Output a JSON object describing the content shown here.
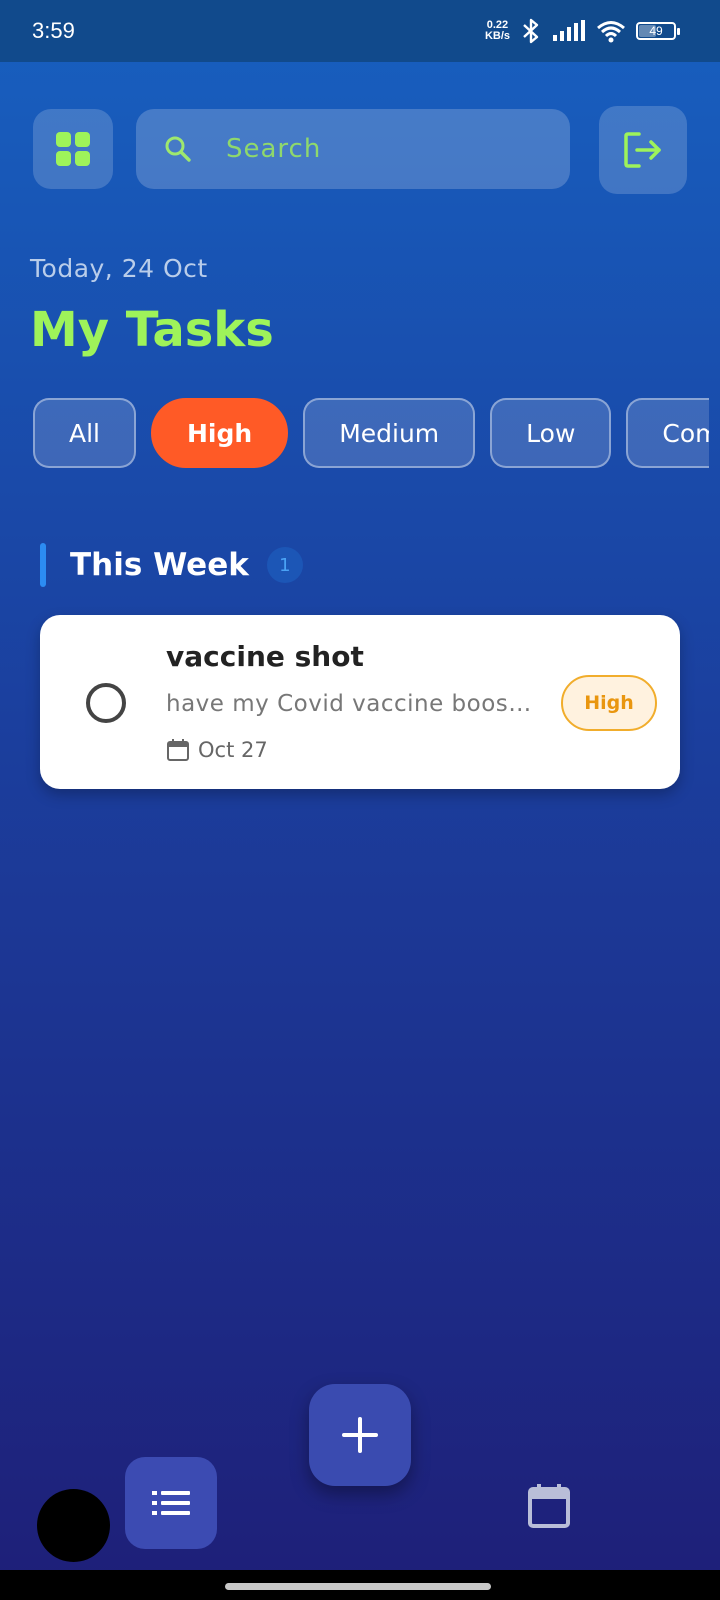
{
  "status_bar": {
    "time": "3:59",
    "net_speed_value": "0.22",
    "net_speed_unit": "KB/s",
    "battery": "49",
    "battery_level": 0.49
  },
  "search": {
    "placeholder": "Search"
  },
  "header": {
    "date": "Today, 24 Oct",
    "title": "My Tasks"
  },
  "filters": [
    {
      "label": "All",
      "active": false
    },
    {
      "label": "High",
      "active": true
    },
    {
      "label": "Medium",
      "active": false
    },
    {
      "label": "Low",
      "active": false
    },
    {
      "label": "Compl",
      "active": false
    }
  ],
  "section": {
    "title": "This Week",
    "count": "1"
  },
  "tasks": [
    {
      "title": "vaccine shot",
      "description": "have my Covid vaccine booster shot",
      "date": "Oct 27",
      "priority": "High"
    }
  ],
  "colors": {
    "accent_green": "#9ef35a",
    "chip_active": "#ff5a26",
    "priority_high": "#e9960f",
    "fab": "#3a4bb0"
  },
  "icons": {
    "menu": "grid-icon",
    "search": "search-icon",
    "logout": "logout-icon",
    "add": "plus-icon",
    "list": "list-icon",
    "calendar": "calendar-icon"
  }
}
